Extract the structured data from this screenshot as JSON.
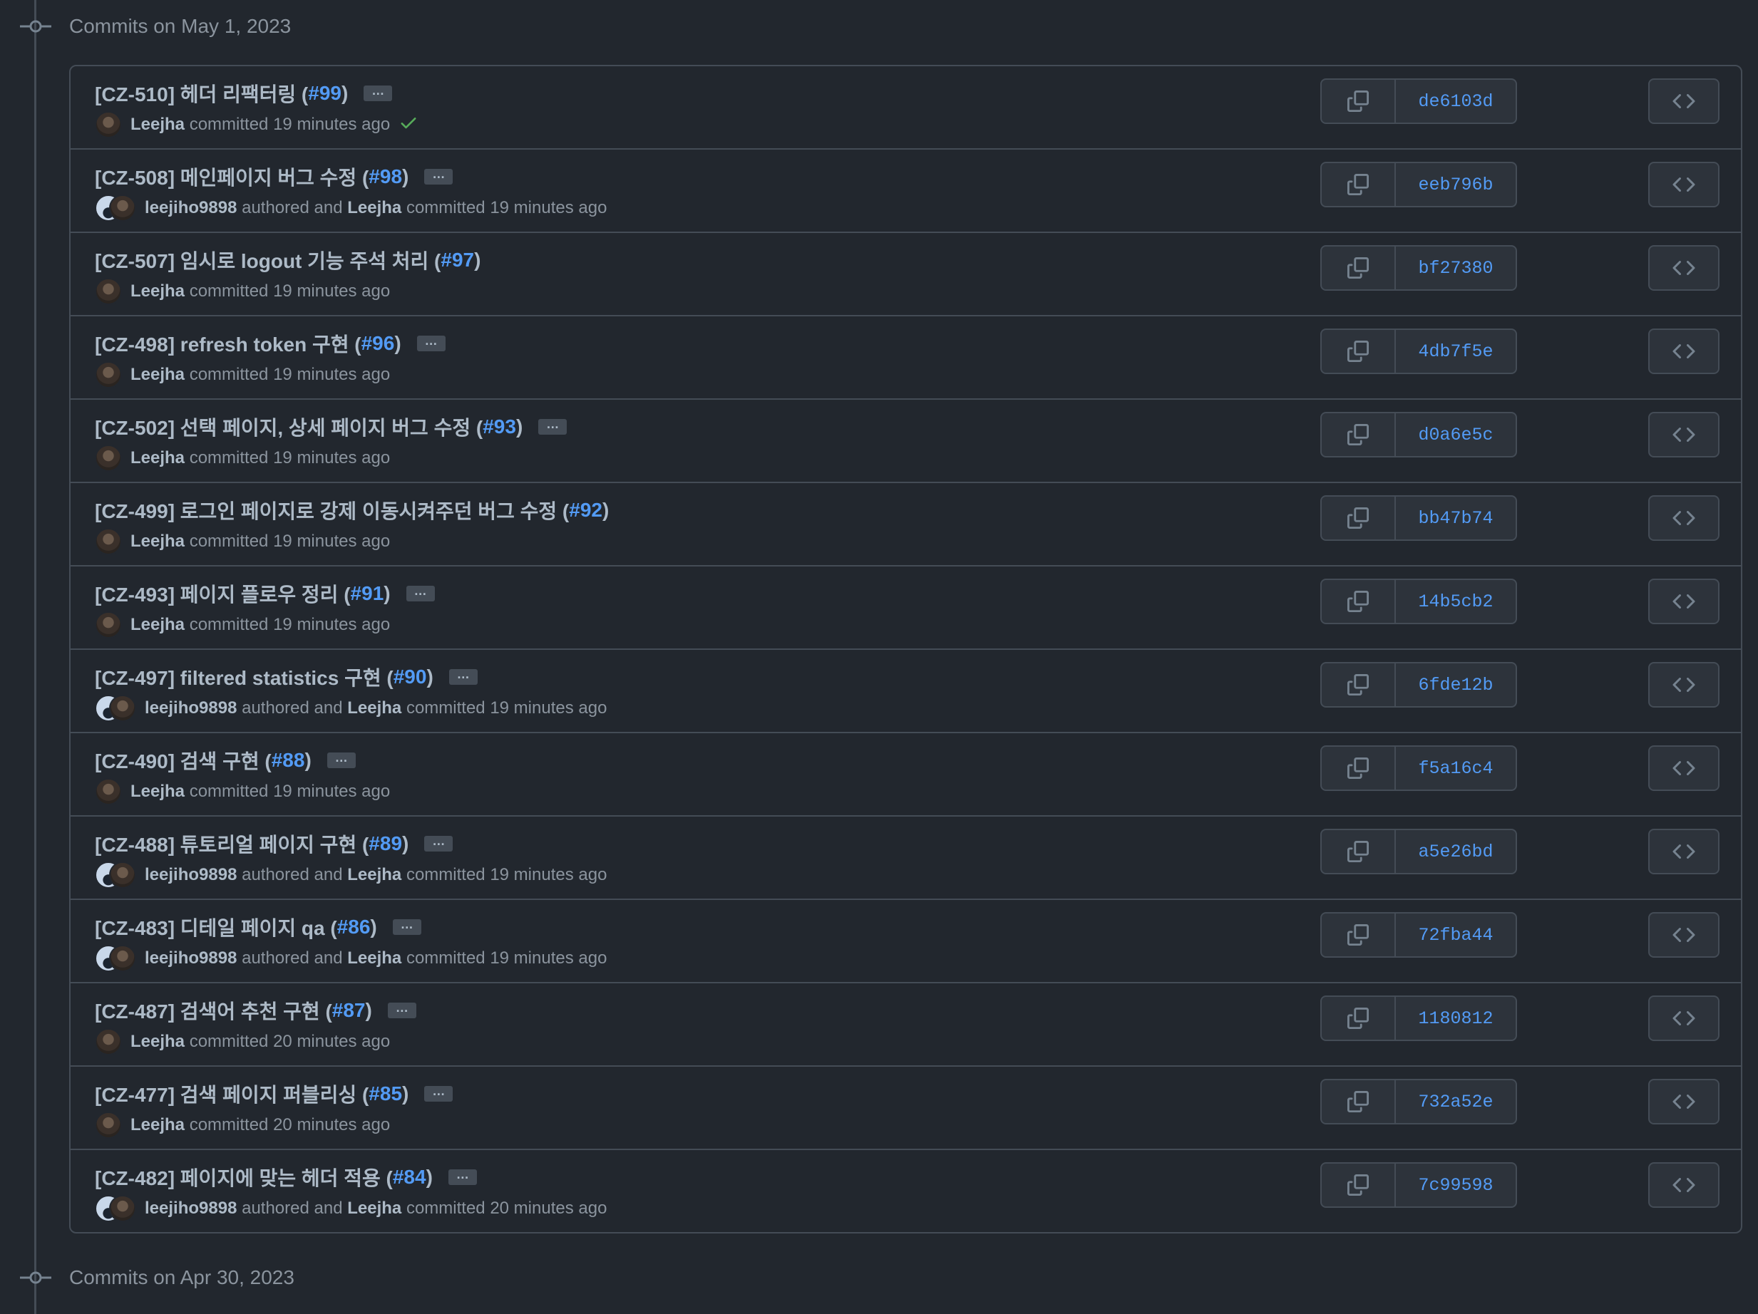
{
  "groups": [
    {
      "title": "Commits on May 1, 2023"
    },
    {
      "title": "Commits on Apr 30, 2023"
    }
  ],
  "labels": {
    "authored_and": "authored and",
    "committed": "committed",
    "ellipsis": "…"
  },
  "colors": {
    "background": "#22272e",
    "border": "#444c56",
    "link": "#539bf5",
    "check": "#57ab5a",
    "muted": "#8b949e"
  },
  "commits": [
    {
      "title": "[CZ-510] 헤더 리팩터링 (",
      "pr": "#99",
      "close": ")",
      "has_ellipsis": true,
      "author": "",
      "committer": "Leejha",
      "time": "19 minutes ago",
      "verified_check": true,
      "sha": "de6103d"
    },
    {
      "title": "[CZ-508] 메인페이지 버그 수정 (",
      "pr": "#98",
      "close": ")",
      "has_ellipsis": true,
      "author": "leejiho9898",
      "committer": "Leejha",
      "time": "19 minutes ago",
      "verified_check": false,
      "sha": "eeb796b"
    },
    {
      "title": "[CZ-507] 임시로 logout 기능 주석 처리 (",
      "pr": "#97",
      "close": ")",
      "has_ellipsis": false,
      "author": "",
      "committer": "Leejha",
      "time": "19 minutes ago",
      "verified_check": false,
      "sha": "bf27380"
    },
    {
      "title": "[CZ-498] refresh token 구현 (",
      "pr": "#96",
      "close": ")",
      "has_ellipsis": true,
      "author": "",
      "committer": "Leejha",
      "time": "19 minutes ago",
      "verified_check": false,
      "sha": "4db7f5e"
    },
    {
      "title": "[CZ-502] 선택 페이지, 상세 페이지 버그 수정 (",
      "pr": "#93",
      "close": ")",
      "has_ellipsis": true,
      "author": "",
      "committer": "Leejha",
      "time": "19 minutes ago",
      "verified_check": false,
      "sha": "d0a6e5c"
    },
    {
      "title": "[CZ-499] 로그인 페이지로 강제 이동시켜주던 버그 수정 (",
      "pr": "#92",
      "close": ")",
      "has_ellipsis": false,
      "author": "",
      "committer": "Leejha",
      "time": "19 minutes ago",
      "verified_check": false,
      "sha": "bb47b74"
    },
    {
      "title": "[CZ-493] 페이지 플로우 정리 (",
      "pr": "#91",
      "close": ")",
      "has_ellipsis": true,
      "author": "",
      "committer": "Leejha",
      "time": "19 minutes ago",
      "verified_check": false,
      "sha": "14b5cb2"
    },
    {
      "title": "[CZ-497] filtered statistics 구현 (",
      "pr": "#90",
      "close": ")",
      "has_ellipsis": true,
      "author": "leejiho9898",
      "committer": "Leejha",
      "time": "19 minutes ago",
      "verified_check": false,
      "sha": "6fde12b"
    },
    {
      "title": "[CZ-490] 검색 구현 (",
      "pr": "#88",
      "close": ")",
      "has_ellipsis": true,
      "author": "",
      "committer": "Leejha",
      "time": "19 minutes ago",
      "verified_check": false,
      "sha": "f5a16c4"
    },
    {
      "title": "[CZ-488] 튜토리얼 페이지 구현 (",
      "pr": "#89",
      "close": ")",
      "has_ellipsis": true,
      "author": "leejiho9898",
      "committer": "Leejha",
      "time": "19 minutes ago",
      "verified_check": false,
      "sha": "a5e26bd"
    },
    {
      "title": "[CZ-483] 디테일 페이지 qa (",
      "pr": "#86",
      "close": ")",
      "has_ellipsis": true,
      "author": "leejiho9898",
      "committer": "Leejha",
      "time": "19 minutes ago",
      "verified_check": false,
      "sha": "72fba44"
    },
    {
      "title": "[CZ-487] 검색어 추천 구현 (",
      "pr": "#87",
      "close": ")",
      "has_ellipsis": true,
      "author": "",
      "committer": "Leejha",
      "time": "20 minutes ago",
      "verified_check": false,
      "sha": "1180812"
    },
    {
      "title": "[CZ-477] 검색 페이지 퍼블리싱 (",
      "pr": "#85",
      "close": ")",
      "has_ellipsis": true,
      "author": "",
      "committer": "Leejha",
      "time": "20 minutes ago",
      "verified_check": false,
      "sha": "732a52e"
    },
    {
      "title": "[CZ-482] 페이지에 맞는 헤더 적용 (",
      "pr": "#84",
      "close": ")",
      "has_ellipsis": true,
      "author": "leejiho9898",
      "committer": "Leejha",
      "time": "20 minutes ago",
      "verified_check": false,
      "sha": "7c99598"
    }
  ]
}
